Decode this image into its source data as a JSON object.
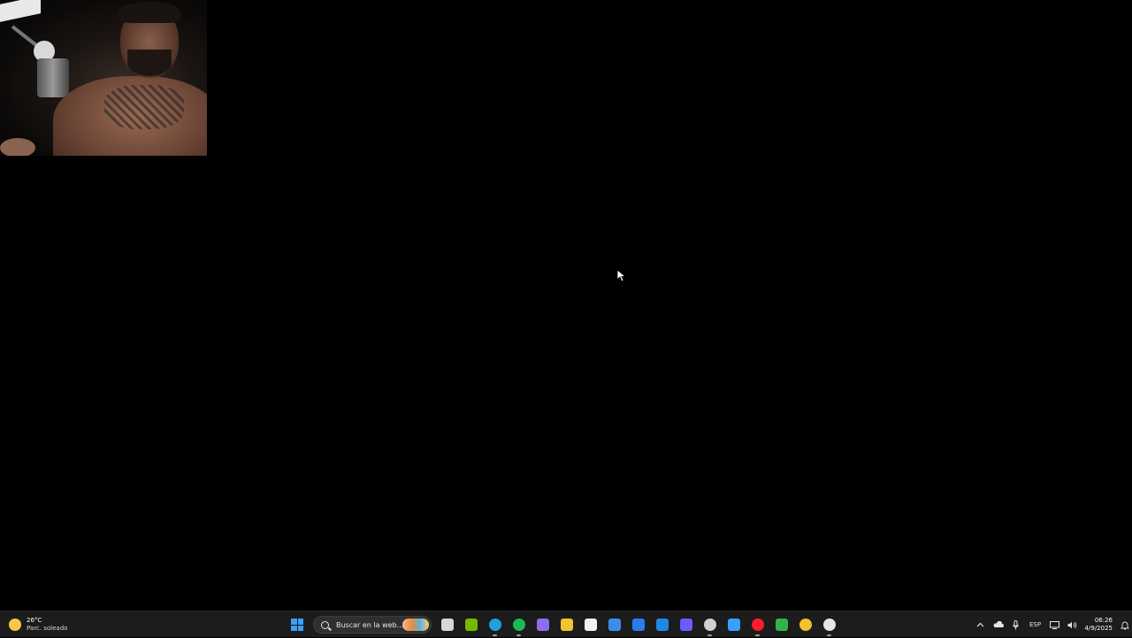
{
  "webcam": {
    "description_label": "webcam"
  },
  "taskbar": {
    "weather": {
      "temperature": "26°C",
      "condition": "Parc. soleado"
    },
    "search": {
      "placeholder": "Buscar en la web..."
    },
    "apps": [
      {
        "name": "task-view",
        "color": "#d8d8d8"
      },
      {
        "name": "nvidia",
        "color": "#76b900"
      },
      {
        "name": "edge",
        "color": "#1fa0e0"
      },
      {
        "name": "spotify",
        "color": "#1db954"
      },
      {
        "name": "copilot",
        "color": "#8f6bf0"
      },
      {
        "name": "file-explorer",
        "color": "#f4c430"
      },
      {
        "name": "notepad",
        "color": "#f2f2f2"
      },
      {
        "name": "store",
        "color": "#3a8ee6"
      },
      {
        "name": "app-blue",
        "color": "#2b7de9"
      },
      {
        "name": "outlook",
        "color": "#1e88e5"
      },
      {
        "name": "photos",
        "color": "#6a5cff"
      },
      {
        "name": "chrome",
        "color": "#d0d0d0"
      },
      {
        "name": "snipping",
        "color": "#3aa0ff"
      },
      {
        "name": "opera",
        "color": "#ff1b2d"
      },
      {
        "name": "app-green",
        "color": "#34b34a"
      },
      {
        "name": "app-yellow",
        "color": "#f2c230"
      },
      {
        "name": "settings",
        "color": "#e6e6e6"
      }
    ],
    "tray": {
      "language": "ESP",
      "time": "06:26",
      "date": "4/9/2025"
    }
  }
}
